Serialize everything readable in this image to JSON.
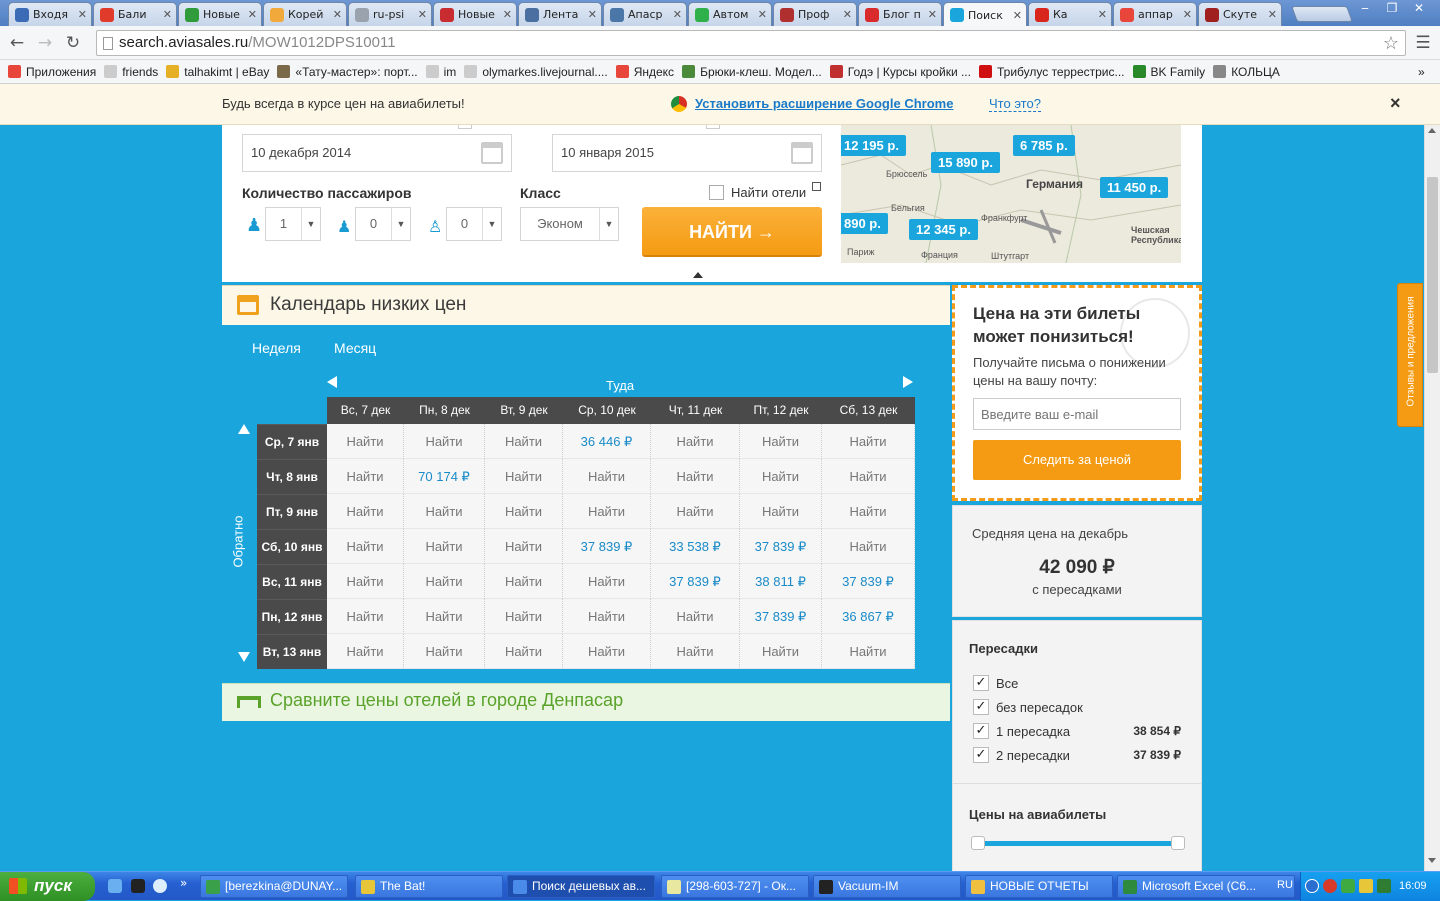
{
  "browser": {
    "tabs": [
      {
        "label": "Входя",
        "color": "#3b6bb5"
      },
      {
        "label": "Бали",
        "color": "#e03a2a"
      },
      {
        "label": "Новые",
        "color": "#2f9b3a"
      },
      {
        "label": "Корей",
        "color": "#f2a93b"
      },
      {
        "label": "ru-psi",
        "color": "#9aa2ad"
      },
      {
        "label": "Новые",
        "color": "#c82b30"
      },
      {
        "label": "Лента",
        "color": "#4a6fa0"
      },
      {
        "label": "Апаср",
        "color": "#4a76a8"
      },
      {
        "label": "Автом",
        "color": "#2fb04a"
      },
      {
        "label": "Проф",
        "color": "#b03030"
      },
      {
        "label": "Блог п",
        "color": "#d92b2b"
      },
      {
        "label": "Поиск",
        "color": "#1aa6dc"
      },
      {
        "label": "Ка",
        "color": "#d9261c"
      },
      {
        "label": "аппар",
        "color": "#e8463a"
      },
      {
        "label": "Скуте",
        "color": "#a02020"
      }
    ],
    "url_host": "search.aviasales.ru",
    "url_path": "/MOW1012DPS10011",
    "bookmarks": [
      {
        "label": "Приложения",
        "color": "#e8463a"
      },
      {
        "label": "friends",
        "color": "#cccccc"
      },
      {
        "label": "talhakimt | eBay",
        "color": "#e5b025"
      },
      {
        "label": "«Тату-мастер»: порт...",
        "color": "#7a6a4a"
      },
      {
        "label": "im",
        "color": "#cccccc"
      },
      {
        "label": "olymarkes.livejournal....",
        "color": "#cccccc"
      },
      {
        "label": "Яндекс",
        "color": "#e8463a"
      },
      {
        "label": "Брюки-клеш. Модел...",
        "color": "#4a8a3a"
      },
      {
        "label": "Годэ | Курсы кройки ...",
        "color": "#c03030"
      },
      {
        "label": "Трибулус террестрис...",
        "color": "#d01010"
      },
      {
        "label": "BK Family",
        "color": "#2a8a2a"
      },
      {
        "label": "КОЛЬЦА",
        "color": "#888888"
      }
    ],
    "more_bookmarks": "»"
  },
  "infobar": {
    "text": "Будь всегда в курсе цен на авиабилеты!",
    "install_link": "Установить расширение Google Chrome",
    "what_link": "Что это?",
    "close": "×"
  },
  "search_form": {
    "depart_date": "10 декабря 2014",
    "return_date": "10 января 2015",
    "passengers_label": "Количество пассажиров",
    "adults": "1",
    "children": "0",
    "infants": "0",
    "class_label": "Класс",
    "class_value": "Эконом",
    "find_hotels_label": "Найти отели",
    "find_button": "НАЙТИ →"
  },
  "map": {
    "prices": [
      "12 195 р.",
      "15 890 р.",
      "6 785 р.",
      "11 450 р.",
      "890 р.",
      "12 345 р."
    ],
    "places": [
      "Германия",
      "Бельгия",
      "Франция",
      "Париж",
      "Чешская Республика",
      "Брюссель",
      "Франкфурт",
      "Штутгарт"
    ]
  },
  "calendar": {
    "title": "Календарь низких цен",
    "period_tabs": [
      "Неделя",
      "Месяц"
    ],
    "outbound_label": "Туда",
    "return_label": "Обратно",
    "columns": [
      "Вс, 7 дек",
      "Пн, 8 дек",
      "Вт, 9 дек",
      "Ср, 10 дек",
      "Чт, 11 дек",
      "Пт, 12 дек",
      "Сб, 13 дек"
    ],
    "rows": [
      {
        "label": "Ср, 7 янв",
        "cells": [
          "Найти",
          "Найти",
          "Найти",
          "36 446 ₽",
          "Найти",
          "Найти",
          "Найти"
        ]
      },
      {
        "label": "Чт, 8 янв",
        "cells": [
          "Найти",
          "70 174 ₽",
          "Найти",
          "Найти",
          "Найти",
          "Найти",
          "Найти"
        ]
      },
      {
        "label": "Пт, 9 янв",
        "cells": [
          "Найти",
          "Найти",
          "Найти",
          "Найти",
          "Найти",
          "Найти",
          "Найти"
        ]
      },
      {
        "label": "Сб, 10 янв",
        "cells": [
          "Найти",
          "Найти",
          "Найти",
          "37 839 ₽",
          "33 538 ₽",
          "37 839 ₽",
          "Найти"
        ]
      },
      {
        "label": "Вс, 11 янв",
        "cells": [
          "Найти",
          "Найти",
          "Найти",
          "Найти",
          "37 839 ₽",
          "38 811 ₽",
          "37 839 ₽"
        ]
      },
      {
        "label": "Пн, 12 янв",
        "cells": [
          "Найти",
          "Найти",
          "Найти",
          "Найти",
          "Найти",
          "37 839 ₽",
          "36 867 ₽"
        ]
      },
      {
        "label": "Вт, 13 янв",
        "cells": [
          "Найти",
          "Найти",
          "Найти",
          "Найти",
          "Найти",
          "Найти",
          "Найти"
        ]
      }
    ]
  },
  "hotels_banner": "Сравните цены отелей в городе Денпасар",
  "subscribe": {
    "title": "Цена на эти билеты может понизиться!",
    "text": "Получайте письма о понижении цены на вашу почту:",
    "placeholder": "Введите ваш e-mail",
    "button": "Следить за ценой"
  },
  "average": {
    "label": "Средняя цена на декабрь",
    "value": "42 090 ₽",
    "note": "с пересадками"
  },
  "filters": {
    "stops_title": "Пересадки",
    "stops": [
      {
        "label": "Все",
        "price": ""
      },
      {
        "label": "без пересадок",
        "price": ""
      },
      {
        "label": "1 пересадка",
        "price": "38 854 ₽"
      },
      {
        "label": "2 пересадки",
        "price": "37 839 ₽"
      }
    ],
    "price_title": "Цены на авиабилеты"
  },
  "feedback_tab": "Отзывы и предложения",
  "taskbar": {
    "start": "пуск",
    "items": [
      "[berezkina@DUNAY...",
      "The Bat!",
      "Поиск дешевых ав...",
      "[298-603-727] - Ок...",
      "Vacuum-IM",
      "НОВЫЕ ОТЧЕТЫ",
      "Microsoft Excel (C6..."
    ],
    "lang": "RU",
    "clock": "16:09"
  }
}
